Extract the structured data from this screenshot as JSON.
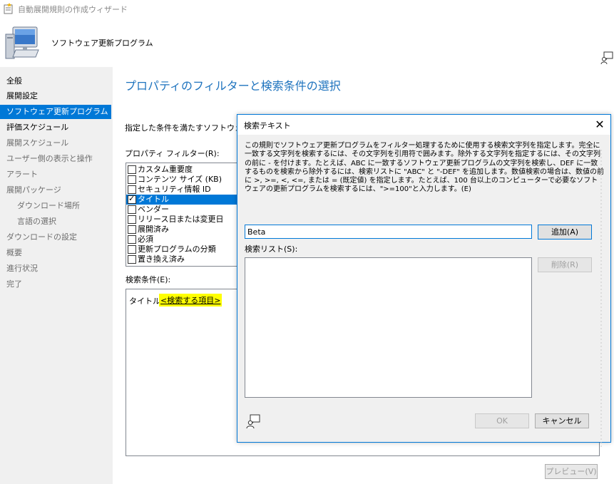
{
  "window": {
    "title": "自動展開規則の作成ウィザード",
    "header_title": "ソフトウェア更新プログラム"
  },
  "sidebar": {
    "items": [
      {
        "label": "全般",
        "state": "normal"
      },
      {
        "label": "展開設定",
        "state": "normal"
      },
      {
        "label": "ソフトウェア更新プログラム",
        "state": "active"
      },
      {
        "label": "評価スケジュール",
        "state": "normal"
      },
      {
        "label": "展開スケジュール",
        "state": "dim"
      },
      {
        "label": "ユーザー側の表示と操作",
        "state": "dim"
      },
      {
        "label": "アラート",
        "state": "dim"
      },
      {
        "label": "展開パッケージ",
        "state": "dim"
      },
      {
        "label": "ダウンロード場所",
        "state": "dim-sub"
      },
      {
        "label": "言語の選択",
        "state": "dim-sub"
      },
      {
        "label": "ダウンロードの設定",
        "state": "dim"
      },
      {
        "label": "概要",
        "state": "dim"
      },
      {
        "label": "進行状況",
        "state": "dim"
      },
      {
        "label": "完了",
        "state": "dim"
      }
    ]
  },
  "main": {
    "heading": "プロパティのフィルターと検索条件の選択",
    "intro": "指定した条件を満たすソフトウェア",
    "filter_label": "プロパティ フィルター(R):",
    "filters": [
      {
        "label": "カスタム重要度",
        "checked": false,
        "selected": false
      },
      {
        "label": "コンテンツ サイズ (KB)",
        "checked": false,
        "selected": false
      },
      {
        "label": "セキュリティ情報 ID",
        "checked": false,
        "selected": false
      },
      {
        "label": "タイトル",
        "checked": true,
        "selected": true
      },
      {
        "label": "ベンダー",
        "checked": false,
        "selected": false
      },
      {
        "label": "リリース日または変更日",
        "checked": false,
        "selected": false
      },
      {
        "label": "展開済み",
        "checked": false,
        "selected": false
      },
      {
        "label": "必須",
        "checked": false,
        "selected": false
      },
      {
        "label": "更新プログラムの分類",
        "checked": false,
        "selected": false
      },
      {
        "label": "置き換え済み",
        "checked": false,
        "selected": false
      }
    ],
    "criteria_label": "検索条件(E):",
    "criteria_title": "タイトル",
    "criteria_link": "<検索する項目>",
    "preview_button": "プレビュー(V)"
  },
  "dialog": {
    "title": "検索テキスト",
    "close_glyph": "✕",
    "description": "この規則でソフトウェア更新プログラムをフィルター処理するために使用する検索文字列を指定します。完全に一致する文字列を検索するには、その文字列を引用符で囲みます。除外する文字列を指定するには、その文字列の前に - を付けます。たとえば、ABC に一致するソフトウェア更新プログラムの文字列を検索し、DEF に一致するものを検索から除外するには、検索リストに \"ABC\" と \"-DEF\" を追加します。数値検索の場合は、数値の前に >, >=, <, <=, または = (既定値) を指定します。たとえば、100 台以上のコンピューターで必要なソフトウェアの更新プログラムを検索するには、\">=100\"と入力します。(E)",
    "input_value": "Beta",
    "add_button": "追加(A)",
    "list_label": "検索リスト(S):",
    "delete_button": "削除(R)",
    "ok_button": "OK",
    "cancel_button": "キャンセル"
  },
  "colors": {
    "accent": "#0078d7",
    "heading": "#1e73be",
    "highlight": "#ffff00",
    "sidebar_bg": "#f0f0f0"
  },
  "icons": [
    "wizard-icon",
    "computer-icon",
    "help-person-icon"
  ]
}
